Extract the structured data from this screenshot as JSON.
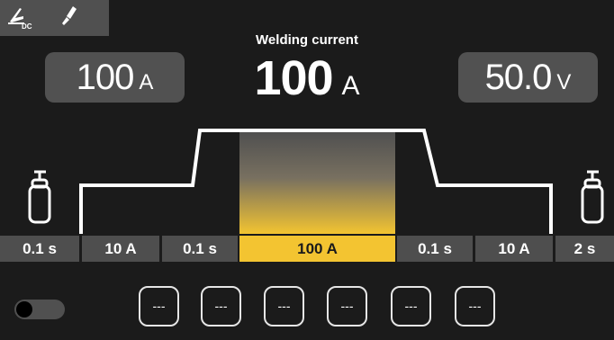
{
  "colors": {
    "background": "#1b1b1b",
    "panel": "#505050",
    "accent": "#f3c431",
    "curve": "#ffffff"
  },
  "mode_icons": [
    "welding-process-icon",
    "torch-icon"
  ],
  "mode_label": "DC",
  "header": {
    "title": "Welding current",
    "value": "100",
    "unit": "A"
  },
  "left_display": {
    "value": "100",
    "unit": "A"
  },
  "right_display": {
    "value": "50.0",
    "unit": "V"
  },
  "gas_icons": [
    "gas-cylinder-icon",
    "gas-cylinder-icon"
  ],
  "segments": [
    {
      "label": "0.1 s",
      "active": false
    },
    {
      "label": "10 A",
      "active": false
    },
    {
      "label": "0.1 s",
      "active": false
    },
    {
      "label": "100 A",
      "active": true
    },
    {
      "label": "0.1 s",
      "active": false
    },
    {
      "label": "10 A",
      "active": false
    },
    {
      "label": "2 s",
      "active": false
    }
  ],
  "toggle": {
    "state": "off"
  },
  "memory_slots": [
    "---",
    "---",
    "---",
    "---",
    "---",
    "---"
  ]
}
